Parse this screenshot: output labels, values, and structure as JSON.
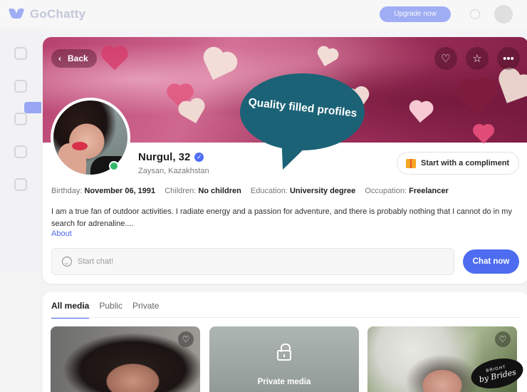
{
  "app": {
    "name": "GoChatty",
    "top_button": "Upgrade now"
  },
  "profile": {
    "back_label": "Back",
    "name": "Nurgul, 32",
    "location": "Zaysan, Kazakhstan",
    "compliment_label": "Start with a compliment",
    "details": [
      {
        "label": "Birthday:",
        "value": "November 06, 1991"
      },
      {
        "label": "Children:",
        "value": "No children"
      },
      {
        "label": "Education:",
        "value": "University degree"
      },
      {
        "label": "Occupation:",
        "value": "Freelancer"
      }
    ],
    "bio": "I am a true fan of outdoor activities. I radiate energy and a passion for adventure, and there is probably nothing that I cannot do in my search for adrenaline....",
    "about_label": "About",
    "chat_placeholder": "Start chat!",
    "chat_button": "Chat now"
  },
  "overlay": {
    "bubble_text": "Quality filled profiles"
  },
  "media": {
    "tabs": [
      "All media",
      "Public",
      "Private"
    ],
    "active_tab": "All media",
    "private_label": "Private media"
  },
  "watermark": {
    "top": "BRIGHT",
    "main": "by Brides"
  },
  "colors": {
    "accent": "#4d6cf0",
    "bubble": "#1b6276",
    "online": "#2fb96b"
  }
}
